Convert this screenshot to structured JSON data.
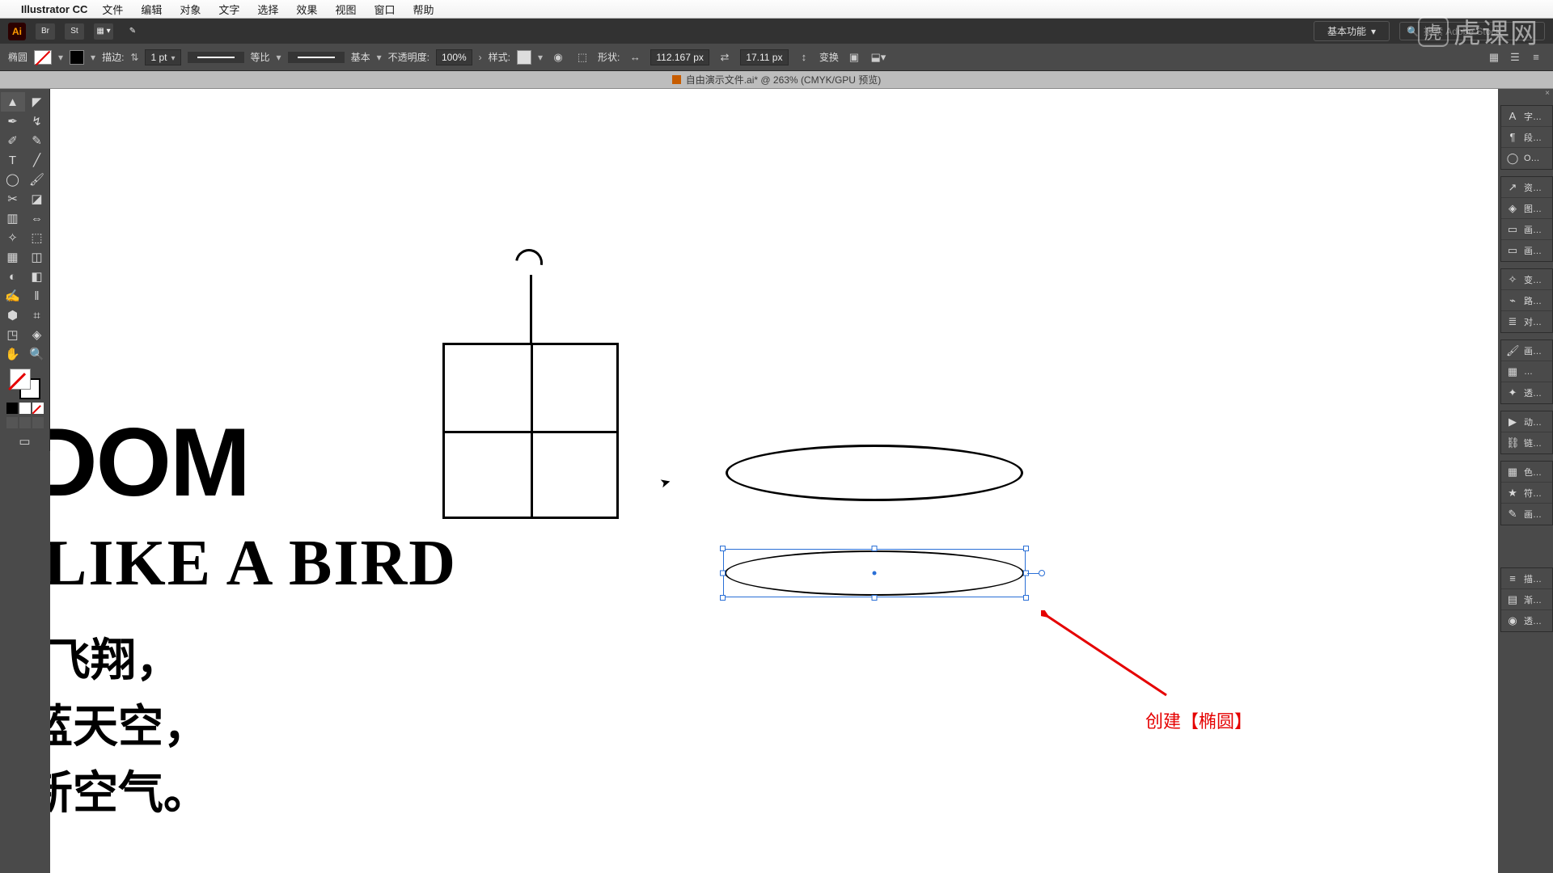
{
  "menubar": {
    "app_name": "Illustrator CC",
    "menus": [
      "文件",
      "编辑",
      "对象",
      "文字",
      "选择",
      "效果",
      "视图",
      "窗口",
      "帮助"
    ]
  },
  "app_toolbar": {
    "ai": "Ai",
    "br": "Br",
    "st": "St",
    "workspace": "基本功能",
    "search_placeholder": "搜索 Adobe Stock"
  },
  "control_bar": {
    "shape_label": "椭圆",
    "stroke_label": "描边:",
    "stroke_weight": "1 pt",
    "stroke_profile": "等比",
    "stroke_brush": "基本",
    "opacity_label": "不透明度:",
    "opacity_val": "100%",
    "style_label": "样式:",
    "shape_label2": "形状:",
    "width_val": "112.167 px",
    "height_val": "17.11 px",
    "transform_label": "变换"
  },
  "document": {
    "title": "自由演示文件.ai* @ 263% (CMYK/GPU 预览)"
  },
  "tools": {
    "list": [
      "▲",
      "◤",
      "✒",
      "↯",
      "✐",
      "✎",
      "T",
      "╱",
      "◯",
      "🖌",
      "✂",
      "◪",
      "▥",
      "⇔",
      "✧",
      "⬚",
      "▦",
      "◫",
      "◐",
      "◧",
      "✍",
      "‖",
      "⬢",
      "⌗",
      "◳",
      "◈",
      "✋",
      "🔍"
    ]
  },
  "right_panels": {
    "g1": [
      {
        "icon": "A",
        "label": "字…"
      },
      {
        "icon": "¶",
        "label": "段…"
      },
      {
        "icon": "◯",
        "label": "O…"
      }
    ],
    "g2": [
      {
        "icon": "↗",
        "label": "资…"
      },
      {
        "icon": "◈",
        "label": "图…"
      },
      {
        "icon": "▭",
        "label": "画…"
      },
      {
        "icon": "▭",
        "label": "画…"
      }
    ],
    "g3": [
      {
        "icon": "✧",
        "label": "变…"
      },
      {
        "icon": "⌁",
        "label": "路…"
      },
      {
        "icon": "≣",
        "label": "对…"
      }
    ],
    "g4": [
      {
        "icon": "🖌",
        "label": "画…"
      },
      {
        "icon": "▦",
        "label": "…"
      },
      {
        "icon": "✦",
        "label": "透…"
      }
    ],
    "g5": [
      {
        "icon": "▶",
        "label": "动…"
      },
      {
        "icon": "⛓",
        "label": "链…"
      }
    ],
    "g6": [
      {
        "icon": "▦",
        "label": "色…"
      },
      {
        "icon": "★",
        "label": "符…"
      },
      {
        "icon": "✎",
        "label": "画…"
      }
    ],
    "g7": [
      {
        "icon": "≡",
        "label": "描…"
      },
      {
        "icon": "▤",
        "label": "渐…"
      },
      {
        "icon": "◉",
        "label": "透…"
      }
    ]
  },
  "artwork": {
    "text1": "DOM",
    "text2": "LIKE A BIRD",
    "cn1": "飞翔，",
    "cn2": "蓝天空，",
    "cn3": "新空气。"
  },
  "annotation": {
    "text": "创建【椭圆】"
  },
  "watermark": {
    "text": "虎课网"
  }
}
